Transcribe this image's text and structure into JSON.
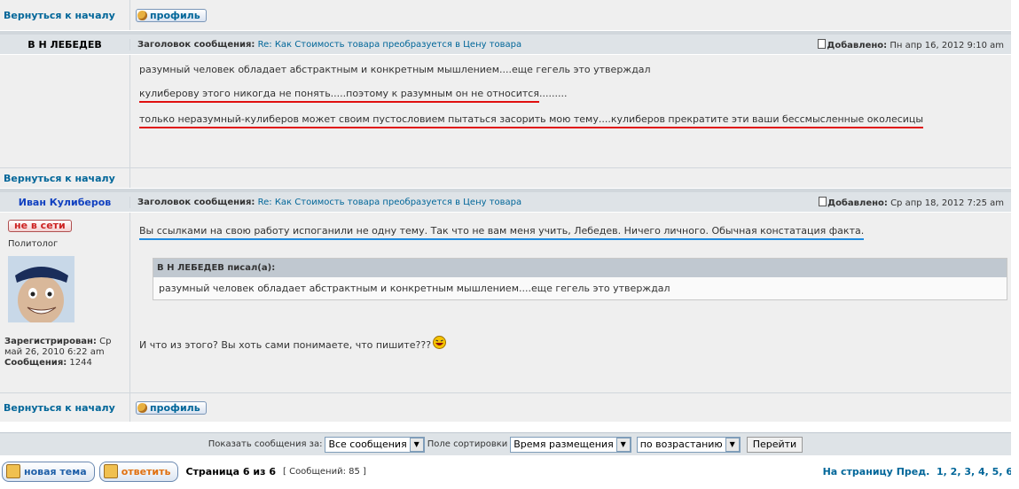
{
  "nav": {
    "back_to_top": "Вернуться к началу",
    "profile_button": "профиль"
  },
  "posts": [
    {
      "author": "В Н ЛЕБЕДЕВ",
      "subject_label": "Заголовок сообщения:",
      "subject_link": "Re: Как Стоимость товара преобразуется в Цену товара",
      "added_label": "Добавлено:",
      "added_date": "Пн апр 16, 2012 9:10 am",
      "lines": [
        "разумный человек обладает абстрактным и конкретным мышлением....еще гегель это утверждал",
        "кулиберову этого никогда не понять.....поэтому к разумным он не относится",
        ".........",
        "только неразумный-кулиберов может своим пустословием пытаться засорить мою тему....кулиберов прекратите эти ваши бессмысленные околесицы"
      ]
    },
    {
      "author": "Иван Кулиберов",
      "status": "не в сети",
      "rank": "Политолог",
      "registered_label": "Зарегистрирован:",
      "registered_value": "Ср май 26, 2010 6:22 am",
      "posts_label": "Сообщения:",
      "posts_value": "1244",
      "subject_label": "Заголовок сообщения:",
      "subject_link": "Re: Как Стоимость товара преобразуется в Цену товара",
      "added_label": "Добавлено:",
      "added_date": "Ср апр 18, 2012 7:25 am",
      "line1": "Вы ссылками на свою работу испоганили не одну тему. Так что не вам меня учить, Лебедев. Ничего личного. Обычная констатация факта.",
      "quote_title": "В Н ЛЕБЕДЕВ писал(а):",
      "quote_text": "разумный человек обладает абстрактным и конкретным мышлением....еще гегель это утверждал",
      "line2": "И что из этого? Вы хоть сами понимаете, что пишите???"
    }
  ],
  "filters": {
    "show_label": "Показать сообщения за:",
    "show_value": "Все сообщения",
    "sort_label": "Поле сортировки",
    "sort_value": "Время размещения",
    "order_value": "по возрастанию",
    "go_button": "Перейти"
  },
  "footer": {
    "new_topic": "новая тема",
    "reply": "ответить",
    "page_info": "Страница 6 из 6",
    "messages_count": "[ Сообщений: 85 ]",
    "goto_label": "На страницу",
    "prev": "Пред.",
    "pages": [
      "1",
      "2",
      "3",
      "4",
      "5",
      "6"
    ]
  }
}
